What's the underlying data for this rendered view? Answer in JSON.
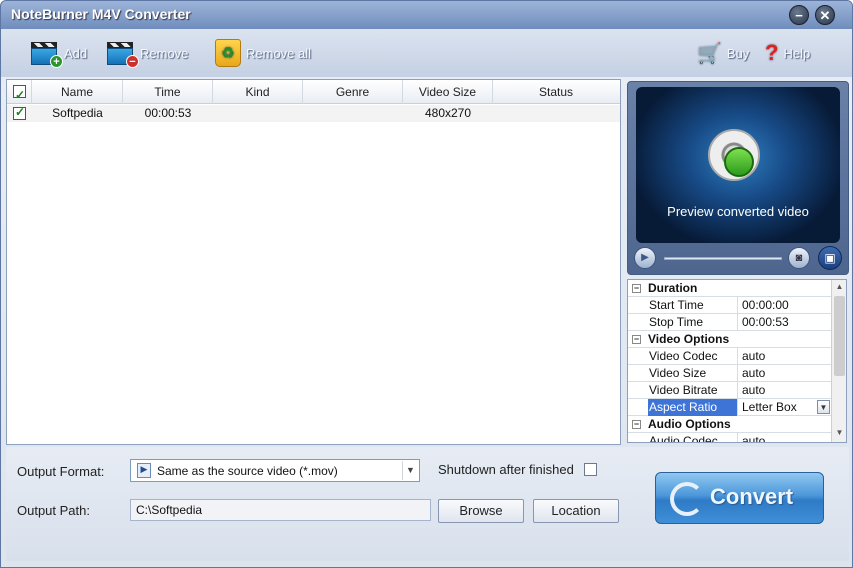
{
  "window": {
    "title": "NoteBurner M4V Converter"
  },
  "toolbar": {
    "add_label": "Add",
    "remove_label": "Remove",
    "remove_all_label": "Remove all",
    "buy_label": "Buy",
    "help_label": "Help"
  },
  "file_list": {
    "columns": [
      "Name",
      "Time",
      "Kind",
      "Genre",
      "Video Size",
      "Status"
    ],
    "rows": [
      {
        "checked": true,
        "name": "Softpedia",
        "time": "00:00:53",
        "kind": "",
        "genre": "",
        "video_size": "480x270",
        "status": ""
      }
    ]
  },
  "preview": {
    "caption": "Preview converted video"
  },
  "properties": {
    "duration_header": "Duration",
    "start_time_label": "Start Time",
    "start_time_value": "00:00:00",
    "stop_time_label": "Stop Time",
    "stop_time_value": "00:00:53",
    "video_header": "Video Options",
    "video_codec_label": "Video Codec",
    "video_codec_value": "auto",
    "video_size_label": "Video Size",
    "video_size_value": "auto",
    "video_bitrate_label": "Video Bitrate",
    "video_bitrate_value": "auto",
    "aspect_ratio_label": "Aspect Ratio",
    "aspect_ratio_value": "Letter Box",
    "audio_header": "Audio Options",
    "audio_codec_label": "Audio Codec",
    "audio_codec_value": "auto"
  },
  "output": {
    "format_label": "Output Format:",
    "format_value": "Same as the source video (*.mov)",
    "shutdown_label": "Shutdown after finished",
    "shutdown_checked": false,
    "path_label": "Output Path:",
    "path_value": "C:\\Softpedia",
    "browse_label": "Browse",
    "location_label": "Location",
    "convert_label": "Convert"
  },
  "colors": {
    "accent": "#3e74d6",
    "title_bar": "#7491bf",
    "convert_button": "#4c97da"
  }
}
